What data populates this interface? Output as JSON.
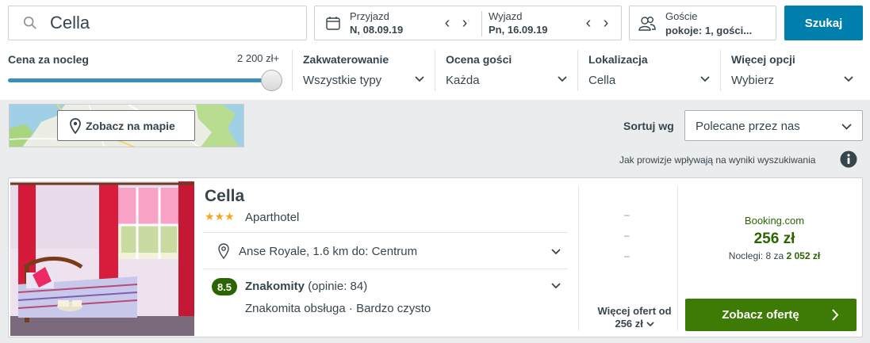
{
  "search": {
    "value": "Cella"
  },
  "dates": {
    "checkin_label": "Przyjazd",
    "checkin_value": "N, 08.09.19",
    "checkout_label": "Wyjazd",
    "checkout_value": "Pn, 16.09.19"
  },
  "guests": {
    "label": "Goście",
    "value": "pokoje: 1, gości..."
  },
  "search_button": "Szukaj",
  "filters": {
    "price": {
      "title": "Cena za nocleg",
      "max_label": "2 200 zł+",
      "slider_fraction": 1.0
    },
    "accommodation": {
      "title": "Zakwaterowanie",
      "value": "Wszystkie typy"
    },
    "rating": {
      "title": "Ocena gości",
      "value": "Każda"
    },
    "location": {
      "title": "Lokalizacja",
      "value": "Cella"
    },
    "more": {
      "title": "Więcej opcji",
      "value": "Wybierz"
    }
  },
  "map": {
    "button_label": "Zobacz na mapie"
  },
  "sort": {
    "label": "Sortuj wg",
    "value": "Polecane przez nas"
  },
  "commission_note": "Jak prowizje wpływają na wyniki wyszukiwania",
  "result": {
    "name": "Cella",
    "stars": 3,
    "stars_text": "★★★",
    "type": "Aparthotel",
    "location": "Anse Royale, 1.6 km do: Centrum",
    "rating_score": "8.5",
    "rating_word": "Znakomity",
    "rating_reviews": "(opinie: 84)",
    "rating_highlights": "Znakomita obsługa · Bardzo czysto",
    "placeholders": [
      "–",
      "–",
      "–"
    ],
    "more_offers_line1": "Więcej ofert od",
    "more_offers_line2": "256 zł",
    "provider": "Booking.com",
    "price": "256 zł",
    "nights_prefix": "Noclegi: 8 za",
    "nights_total": "2 052 zł",
    "offer_button": "Zobacz ofertę"
  },
  "colors": {
    "primary_blue": "#007faf",
    "deal_green": "#2b6502",
    "button_green": "#3e7a06",
    "text": "#37454d",
    "star": "#f5a623"
  }
}
